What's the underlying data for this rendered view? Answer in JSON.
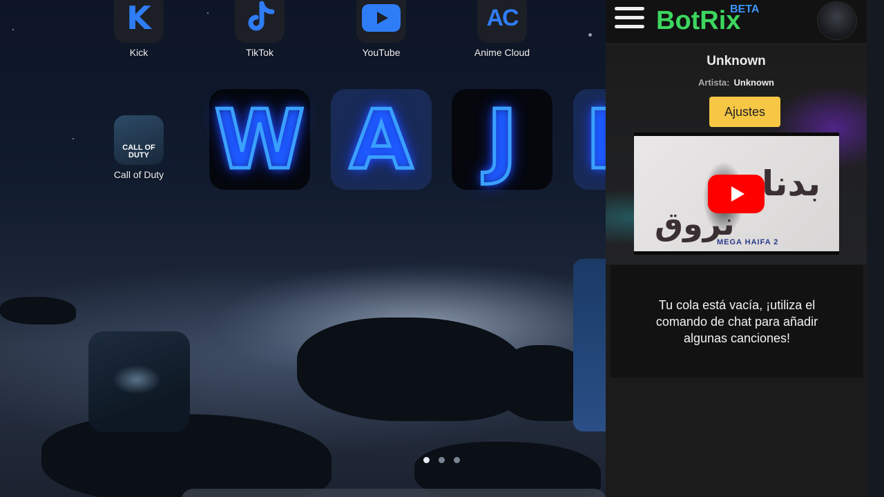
{
  "apps": [
    {
      "name": "kick",
      "label": "Kick",
      "glyph": "K"
    },
    {
      "name": "tiktok",
      "label": "TikTok"
    },
    {
      "name": "youtube",
      "label": "YouTube"
    },
    {
      "name": "anime-cloud",
      "label": "Anime Cloud",
      "glyph": "AC"
    },
    {
      "name": "call-of-duty",
      "label": "Call of Duty",
      "glyph": "CALL OF DUTY"
    }
  ],
  "neon_tiles": [
    "W",
    "A",
    "J",
    "I"
  ],
  "page_indicator": {
    "pages": 3,
    "current": 1
  },
  "botrix": {
    "brand": "BotRix",
    "badge": "BETA",
    "now_playing": {
      "title": "Unknown",
      "artist_label": "Artista:",
      "artist": "Unknown"
    },
    "settings_button": "Ajustes",
    "video_thumbnail": {
      "arabic_line_1": "بدنا",
      "arabic_line_2": "نروق",
      "caption": "MEGA HAIFA 2"
    },
    "queue_empty_message": "Tu cola está vacía, ¡utiliza el comando de chat para añadir algunas canciones!"
  },
  "colors": {
    "brand_green": "#3dd65f",
    "beta_blue": "#3b97ff",
    "settings_yellow": "#f6c744",
    "youtube_red": "#ff0000",
    "neon_blue": "#3aa0ff"
  }
}
